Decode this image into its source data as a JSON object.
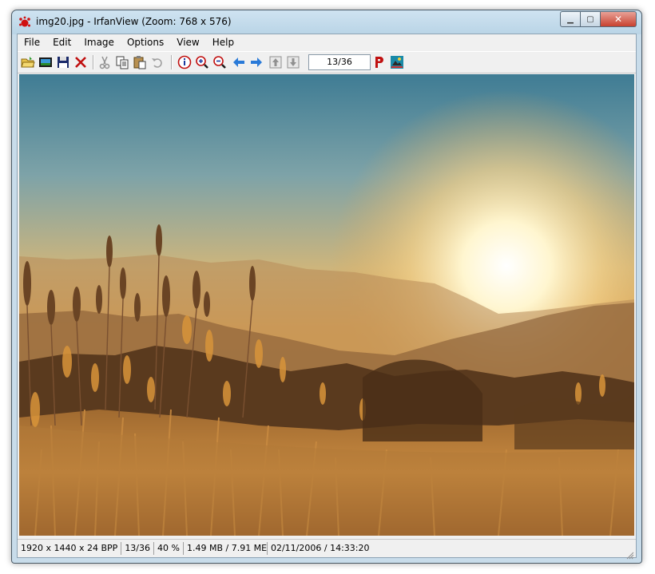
{
  "window": {
    "title": "img20.jpg - IrfanView (Zoom: 768 x 576)",
    "accent": "#4a5a66",
    "close_color": "#c8412f"
  },
  "menu": {
    "items": [
      "File",
      "Edit",
      "Image",
      "Options",
      "View",
      "Help"
    ]
  },
  "toolbar": {
    "buttons": [
      "open-folder-icon",
      "slideshow-icon",
      "save-icon",
      "delete-icon",
      "cut-icon",
      "copy-icon",
      "paste-icon",
      "undo-icon",
      "info-icon",
      "zoom-in-icon",
      "zoom-out-icon",
      "previous-icon",
      "next-icon",
      "first-icon",
      "last-icon",
      "print-p-icon",
      "paint-icon"
    ],
    "page": "13/36"
  },
  "image": {
    "description_icon": "photo-sunset-meadow"
  },
  "status": {
    "resolution": "1920 x 1440 x 24 BPP",
    "index": "13/36",
    "zoom": "40 %",
    "size": "1.49 MB / 7.91 ME",
    "datetime": "02/11/2006 / 14:33:20"
  }
}
